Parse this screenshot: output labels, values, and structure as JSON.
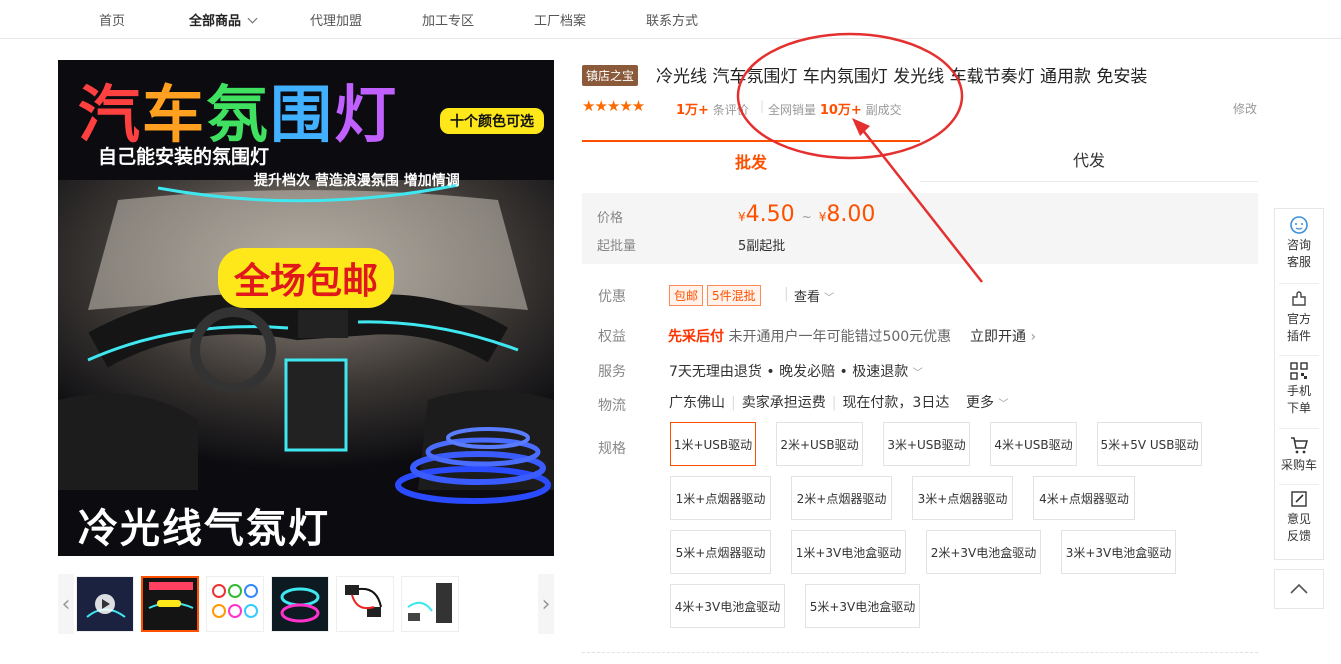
{
  "topnav": {
    "items": [
      "首页",
      "全部商品",
      "代理加盟",
      "加工专区",
      "工厂档案",
      "联系方式"
    ]
  },
  "main_image": {
    "title_chars": [
      "汽",
      "车",
      "氛",
      "围",
      "灯"
    ],
    "badge": "十个颜色可选",
    "subtitle1": "自己能安装的氛围灯",
    "subtitle2": "提升档次 营造浪漫氛围 增加情调",
    "shipping": "全场包邮",
    "bottom_text": "冷光线气氛灯"
  },
  "product": {
    "store_tag": "镇店之宝",
    "title": "冷光线 汽车氛围灯 车内氛围灯 发光线 车载节奏灯 通用款 免安装",
    "stars": "★★★★★",
    "review_count": "1万+",
    "review_suffix": "条评价",
    "sales_prefix": "全网销量",
    "sales_count": "10万+",
    "sales_suffix": "副成交",
    "modify": "修改"
  },
  "tabs": [
    "批发",
    "代发"
  ],
  "price": {
    "price_label": "价格",
    "currency": "¥",
    "low": "4.50",
    "tilde": "~",
    "high": "8.00",
    "moq_label": "起批量",
    "moq_value": "5副起批"
  },
  "rows": {
    "promo_label": "优惠",
    "promo_pills": [
      "包邮",
      "5件混批"
    ],
    "promo_view": "查看",
    "rights_label": "权益",
    "rights_strong": "先采后付",
    "rights_text": "未开通用户一年可能错过500元优惠",
    "rights_link": "立即开通",
    "service_label": "服务",
    "service_text": "7天无理由退货 • 晚发必赔 • 极速退款",
    "logistics_label": "物流",
    "logistics_from": "广东佛山",
    "logistics_fee": "卖家承担运费",
    "logistics_eta": "现在付款，3日达",
    "logistics_more": "更多",
    "spec_label": "规格"
  },
  "specs": [
    "1米+USB驱动",
    "2米+USB驱动",
    "3米+USB驱动",
    "4米+USB驱动",
    "5米+5V USB驱动",
    "1米+点烟器驱动",
    "2米+点烟器驱动",
    "3米+点烟器驱动",
    "4米+点烟器驱动",
    "5米+点烟器驱动",
    "1米+3V电池盒驱动",
    "2米+3V电池盒驱动",
    "3米+3V电池盒驱动",
    "4米+3V电池盒驱动",
    "5米+3V电池盒驱动"
  ],
  "selected_spec": "1米+USB驱动",
  "sidebar": [
    {
      "line1": "咨询",
      "line2": "客服",
      "icon": "chat-icon"
    },
    {
      "line1": "官方",
      "line2": "插件",
      "icon": "puzzle-icon"
    },
    {
      "line1": "手机",
      "line2": "下单",
      "icon": "qr-code-icon"
    },
    {
      "line1": "采购车",
      "line2": "",
      "icon": "cart-icon"
    },
    {
      "line1": "意见",
      "line2": "反馈",
      "icon": "feedback-icon"
    }
  ],
  "colors": {
    "accent": "#ff5000",
    "annotation_red": "#e53030",
    "neon_cyan": "#3fe8f0",
    "neon_blue": "#2a4bff"
  }
}
